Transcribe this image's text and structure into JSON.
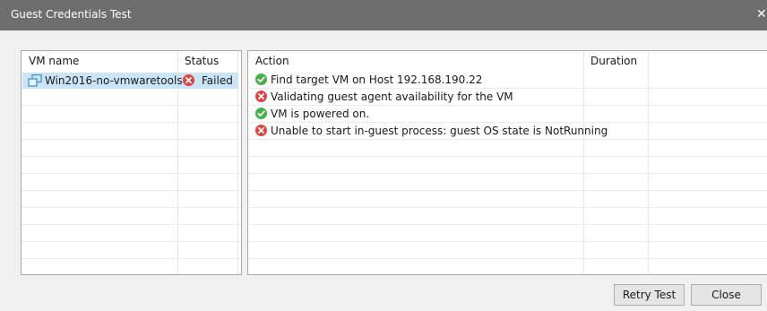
{
  "window": {
    "title": "Guest Credentials Test"
  },
  "vm_table": {
    "columns": [
      "VM name",
      "Status"
    ],
    "rows": [
      {
        "name": "Win2016-no-vmwaretools",
        "status": "Failed"
      }
    ]
  },
  "action_table": {
    "columns": [
      "Action",
      "Duration"
    ],
    "rows": [
      {
        "icon": "success-icon",
        "text": "Find target VM on Host 192.168.190.22",
        "duration": ""
      },
      {
        "icon": "error-icon",
        "text": "Validating guest agent availability for the VM",
        "duration": ""
      },
      {
        "icon": "success-icon",
        "text": "VM is powered on.",
        "duration": ""
      },
      {
        "icon": "error-icon",
        "text": "Unable to start in-guest process: guest OS state is NotRunning",
        "duration": ""
      }
    ]
  },
  "buttons": {
    "retry": "Retry Test",
    "close": "Close"
  },
  "colors": {
    "title_bar": "#6e6e6e",
    "selection": "#cce4f7",
    "success": "#48b04a",
    "error": "#e0443e"
  }
}
